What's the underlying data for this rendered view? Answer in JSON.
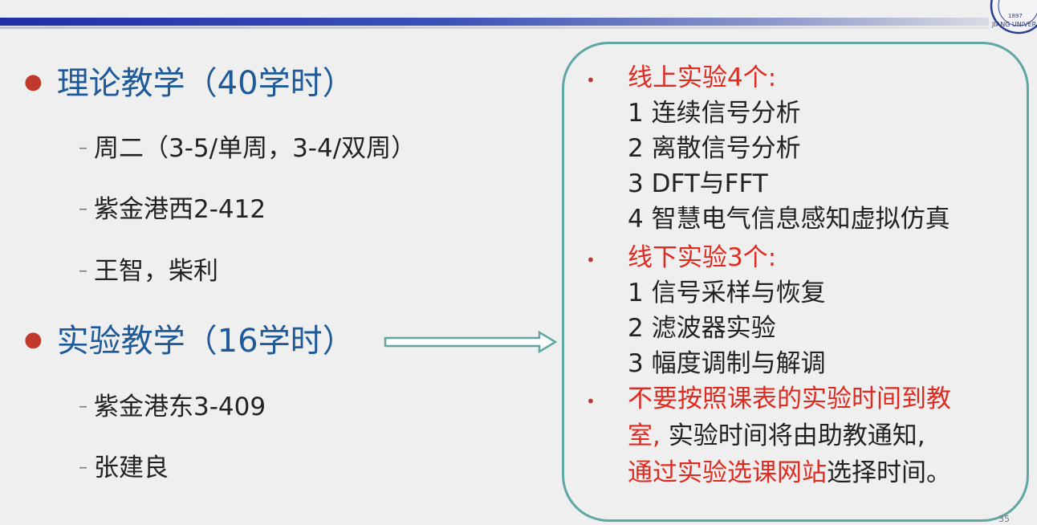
{
  "left": {
    "theory_title": "理论教学（40学时）",
    "theory_items": [
      "周二（3-5/单周，3-4/双周）",
      "紫金港西2-412",
      "王智，柴利"
    ],
    "lab_title": "实验教学（16学时）",
    "lab_items": [
      "紫金港东3-409",
      "张建良"
    ]
  },
  "box": {
    "online_heading": "线上实验4个:",
    "online_items": [
      "1 连续信号分析",
      "2 离散信号分析",
      "3 DFT与FFT",
      "4 智慧电气信息感知虚拟仿真"
    ],
    "offline_heading": "线下实验3个:",
    "offline_items": [
      "1 信号采样与恢复",
      "2 滤波器实验",
      "3 幅度调制与解调"
    ],
    "note_red_1": "不要按照课表的实验时间到教",
    "note_red_2": "室,",
    "note_black_2": " 实验时间将由助教通知,",
    "note_red_3": "通过实验选课网站",
    "note_black_3": "选择时间。"
  },
  "logo_text": "1897 JIANG UNIVER",
  "page_number": "35",
  "colors": {
    "heading_blue": "#1e5a9a",
    "bullet_red": "#c0392b",
    "emphasis_red": "#e02a20",
    "box_border": "#5fa8a2"
  }
}
